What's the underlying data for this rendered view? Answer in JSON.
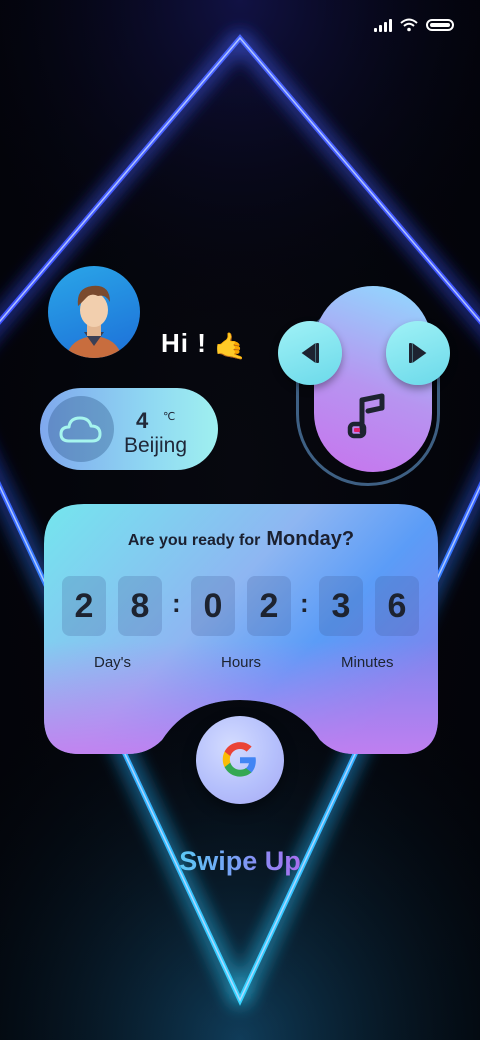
{
  "status_bar": {
    "icons": [
      "signal-icon",
      "wifi-icon",
      "battery-icon"
    ]
  },
  "profile": {
    "greeting": "Hi !",
    "wave_emoji": "🤙"
  },
  "weather": {
    "temperature": "4",
    "unit": "℃",
    "city": "Beijing",
    "icon": "cloud-icon"
  },
  "music": {
    "icons": [
      "previous-icon",
      "music-note-icon",
      "next-icon"
    ]
  },
  "countdown": {
    "question": "Are you ready for",
    "day_name": "Monday?",
    "digits": [
      "2",
      "8",
      "0",
      "2",
      "3",
      "6"
    ],
    "separator": ":",
    "labels": [
      "Day's",
      "Hours",
      "Minutes"
    ]
  },
  "google": {
    "icon": "google-icon"
  },
  "swipe_label": "Swipe Up",
  "colors": {
    "neon_top": "#3a5cff",
    "neon_bottom": "#35c8ff",
    "card_start": "#74e6ee",
    "card_end": "#c281ee",
    "text_dark": "#1d2330"
  }
}
